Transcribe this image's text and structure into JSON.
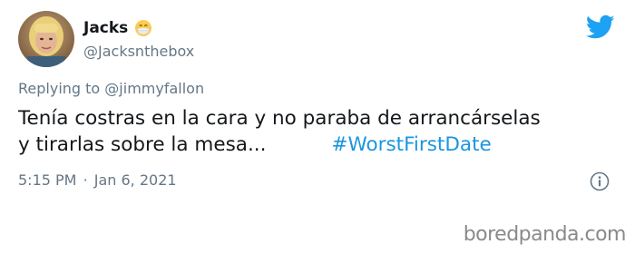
{
  "tweet": {
    "display_name": "Jacks",
    "display_name_emoji": "face-with-medical-mask",
    "handle": "@Jacksnthebox",
    "replying_prefix": "Replying to",
    "replying_to": "@jimmyfallon",
    "text_line_1": "Tenía costras en la cara y no paraba de arrancárselas",
    "text_line_2": "y tirarlas sobre la mesa...",
    "hashtag": "#WorstFirstDate",
    "time": "5:15 PM",
    "separator": "·",
    "date": "Jan 6, 2021"
  },
  "icons": {
    "brand": "twitter-bird-icon",
    "info": "info-icon"
  },
  "watermark": {
    "text": "boredpanda.com"
  },
  "colors": {
    "text_primary": "#14171a",
    "text_secondary": "#657786",
    "twitter_blue": "#1da1f2",
    "hashtag_blue": "#1b95e0",
    "watermark_gray": "#8a8a8a"
  }
}
